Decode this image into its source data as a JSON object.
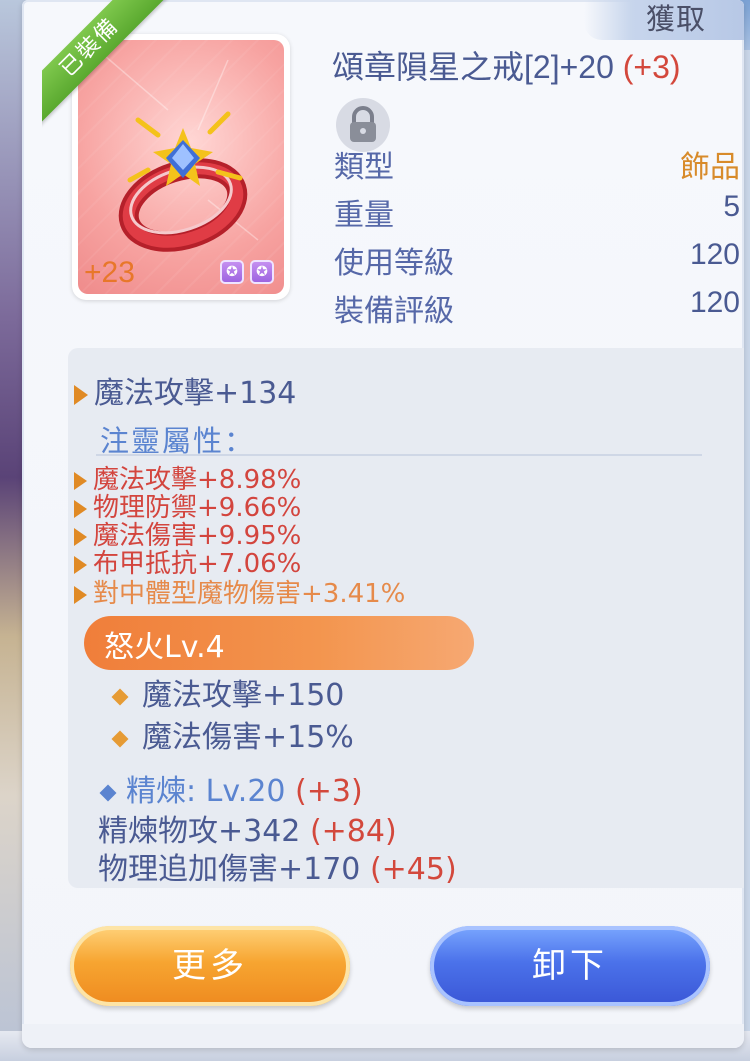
{
  "tabs": {
    "acquire": "獲取"
  },
  "item": {
    "equipped_ribbon": "已裝備",
    "enhance_level": "+23",
    "card_slots": [
      "✪",
      "✪"
    ],
    "name": "頌章隕星之戒[2]+20",
    "name_bonus": "(+3)",
    "lock_icon": "lock-icon",
    "info": [
      {
        "label": "類型",
        "value": "飾品"
      },
      {
        "label": "重量",
        "value": "5"
      },
      {
        "label": "使用等級",
        "value": "120"
      },
      {
        "label": "裝備評級",
        "value": "120"
      }
    ]
  },
  "stats": {
    "base": "魔法攻擊+134",
    "enchant_header": "注靈屬性：",
    "enchant": [
      "魔法攻擊+8.98%",
      "物理防禦+9.66%",
      "魔法傷害+9.95%",
      "布甲抵抗+7.06%"
    ],
    "enchant_special": "對中體型魔物傷害+3.41%",
    "skill": {
      "name": "怒火Lv.4",
      "effects": [
        "魔法攻擊+150",
        "魔法傷害+15%"
      ]
    },
    "refine": {
      "label": "精煉: Lv.20",
      "bonus": "(+3)"
    },
    "refine_stats": [
      {
        "text": "精煉物攻+342",
        "bonus": "(+84)"
      },
      {
        "text": "物理追加傷害+170",
        "bonus": "(+45)"
      }
    ]
  },
  "buttons": {
    "more": "更多",
    "unequip": "卸下"
  },
  "colors": {
    "name": "#4a5a92",
    "bonus_red": "#d3483c",
    "enchant_red": "#d3453e",
    "enchant_orange": "#e68a4a",
    "more_button": "#f7a531",
    "unequip_button": "#4b72ea"
  }
}
